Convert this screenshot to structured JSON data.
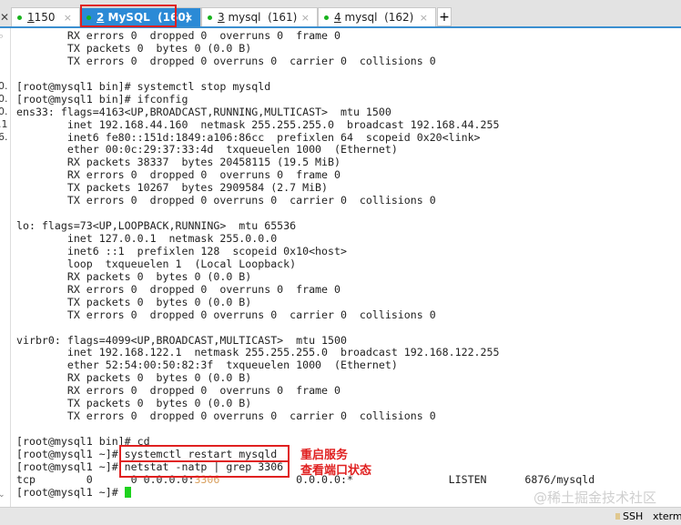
{
  "tabs": [
    {
      "num": "1",
      "label": " 150"
    },
    {
      "num": "2",
      "label": " MySQL  (160)"
    },
    {
      "num": "3",
      "label": " mysql  (161)"
    },
    {
      "num": "4",
      "label": " mysql  (162)"
    }
  ],
  "left_strip": [
    "0.",
    "0.",
    "0.",
    ".1",
    "6."
  ],
  "terminal": {
    "lines": [
      "        RX errors 0  dropped 0  overruns 0  frame 0",
      "        TX packets 0  bytes 0 (0.0 B)",
      "        TX errors 0  dropped 0 overruns 0  carrier 0  collisions 0",
      "",
      "[root@mysql1 bin]# systemctl stop mysqld",
      "[root@mysql1 bin]# ifconfig",
      "ens33: flags=4163<UP,BROADCAST,RUNNING,MULTICAST>  mtu 1500",
      "        inet 192.168.44.160  netmask 255.255.255.0  broadcast 192.168.44.255",
      "        inet6 fe80::151d:1849:a106:86cc  prefixlen 64  scopeid 0x20<link>",
      "        ether 00:0c:29:37:33:4d  txqueuelen 1000  (Ethernet)",
      "        RX packets 38337  bytes 20458115 (19.5 MiB)",
      "        RX errors 0  dropped 0  overruns 0  frame 0",
      "        TX packets 10267  bytes 2909584 (2.7 MiB)",
      "        TX errors 0  dropped 0 overruns 0  carrier 0  collisions 0",
      "",
      "lo: flags=73<UP,LOOPBACK,RUNNING>  mtu 65536",
      "        inet 127.0.0.1  netmask 255.0.0.0",
      "        inet6 ::1  prefixlen 128  scopeid 0x10<host>",
      "        loop  txqueuelen 1  (Local Loopback)",
      "        RX packets 0  bytes 0 (0.0 B)",
      "        RX errors 0  dropped 0  overruns 0  frame 0",
      "        TX packets 0  bytes 0 (0.0 B)",
      "        TX errors 0  dropped 0 overruns 0  carrier 0  collisions 0",
      "",
      "virbr0: flags=4099<UP,BROADCAST,MULTICAST>  mtu 1500",
      "        inet 192.168.122.1  netmask 255.255.255.0  broadcast 192.168.122.255",
      "        ether 52:54:00:50:82:3f  txqueuelen 1000  (Ethernet)",
      "        RX packets 0  bytes 0 (0.0 B)",
      "        RX errors 0  dropped 0  overruns 0  frame 0",
      "        TX packets 0  bytes 0 (0.0 B)",
      "        TX errors 0  dropped 0 overruns 0  carrier 0  collisions 0",
      "",
      "[root@mysql1 bin]# cd",
      "[root@mysql1 ~]# systemctl restart mysqld",
      "[root@mysql1 ~]# netstat -natp | grep 3306"
    ],
    "tcp_line": {
      "pre": "tcp        0      0 0.0.0.0:",
      "port": "3306",
      "post": "            0.0.0.0:*               LISTEN      6876/mysqld"
    },
    "prompt": "[root@mysql1 ~]# "
  },
  "annotations": {
    "restart": "重启服务",
    "netstat": "查看端口状态"
  },
  "watermark": "@稀土掘金技术社区",
  "status": {
    "protocol": "SSH",
    "terminal_type": "xterm"
  }
}
